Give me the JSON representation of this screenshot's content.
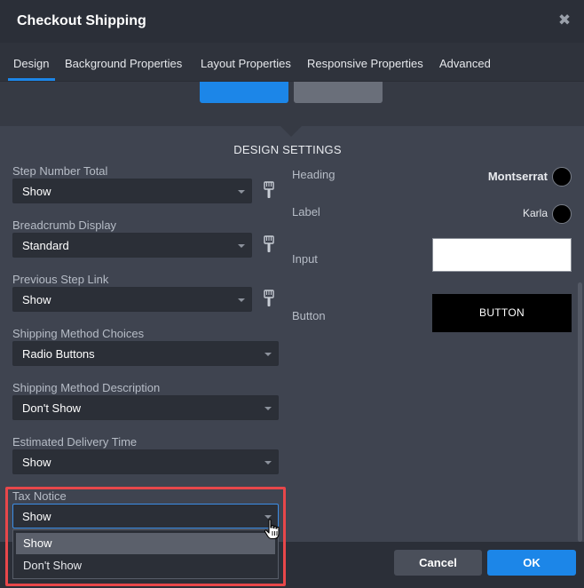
{
  "window": {
    "title": "Checkout Shipping",
    "close_glyph": "✖"
  },
  "tabs": [
    {
      "label": "Design",
      "active": true
    },
    {
      "label": "Background Properties"
    },
    {
      "label": "Layout Properties"
    },
    {
      "label": "Responsive Properties"
    },
    {
      "label": "Advanced"
    }
  ],
  "section_title": "DESIGN SETTINGS",
  "fields": {
    "step_number_total": {
      "label": "Step Number Total",
      "value": "Show"
    },
    "breadcrumb_display": {
      "label": "Breadcrumb Display",
      "value": "Standard"
    },
    "previous_step_link": {
      "label": "Previous Step Link",
      "value": "Show"
    },
    "shipping_method_choices": {
      "label": "Shipping Method Choices",
      "value": "Radio Buttons"
    },
    "shipping_method_description": {
      "label": "Shipping Method Description",
      "value": "Don't Show"
    },
    "estimated_delivery_time": {
      "label": "Estimated Delivery Time",
      "value": "Show"
    },
    "tax_notice": {
      "label": "Tax Notice",
      "value": "Show",
      "options": [
        "Show",
        "Don't Show"
      ]
    }
  },
  "styles": {
    "heading": {
      "label": "Heading",
      "font": "Montserrat",
      "color": "#000000"
    },
    "label": {
      "label": "Label",
      "font": "Karla",
      "color": "#000000"
    },
    "input": {
      "label": "Input",
      "color": "#ffffff"
    },
    "button": {
      "label": "Button",
      "text": "BUTTON",
      "color": "#000000"
    }
  },
  "footer": {
    "cancel": "Cancel",
    "ok": "OK"
  },
  "colors": {
    "accent": "#1c86e8",
    "highlight": "#e8474a"
  },
  "icons": [
    "close-icon",
    "paint-brush-icon",
    "chevron-down-icon",
    "hand-pointer-cursor"
  ]
}
